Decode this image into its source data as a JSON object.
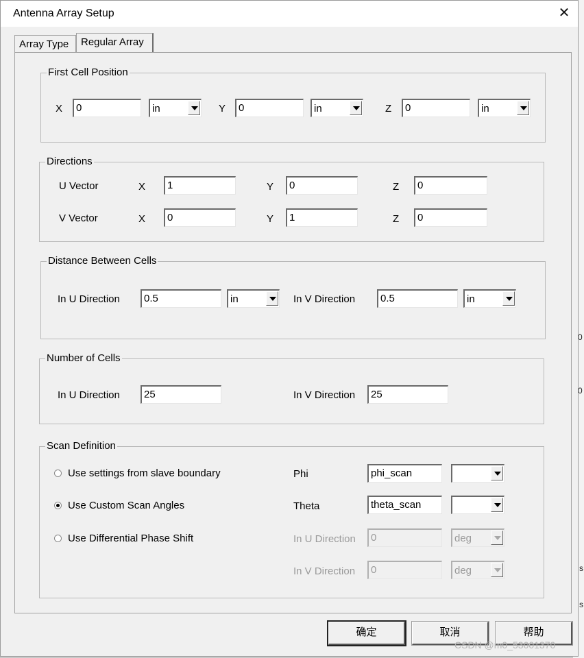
{
  "window": {
    "title": "Antenna Array Setup",
    "close_glyph": "✕"
  },
  "tabs": [
    {
      "label": "Array Type"
    },
    {
      "label": "Regular Array"
    }
  ],
  "first_cell": {
    "legend": "First Cell Position",
    "x_label": "X",
    "x_value": "0",
    "x_unit": "in",
    "y_label": "Y",
    "y_value": "0",
    "y_unit": "in",
    "z_label": "Z",
    "z_value": "0",
    "z_unit": "in"
  },
  "directions": {
    "legend": "Directions",
    "u_label": "U Vector",
    "v_label": "V Vector",
    "x_label": "X",
    "y_label": "Y",
    "z_label": "Z",
    "u": {
      "x": "1",
      "y": "0",
      "z": "0"
    },
    "v": {
      "x": "0",
      "y": "1",
      "z": "0"
    }
  },
  "distance": {
    "legend": "Distance Between Cells",
    "u_label": "In U Direction",
    "u_value": "0.5",
    "u_unit": "in",
    "v_label": "In V Direction",
    "v_value": "0.5",
    "v_unit": "in"
  },
  "number": {
    "legend": "Number of Cells",
    "u_label": "In U Direction",
    "u_value": "25",
    "v_label": "In V Direction",
    "v_value": "25"
  },
  "scan": {
    "legend": "Scan Definition",
    "options": [
      {
        "label": "Use settings from slave boundary",
        "checked": false
      },
      {
        "label": "Use Custom Scan Angles",
        "checked": true
      },
      {
        "label": "Use Differential Phase Shift",
        "checked": false
      }
    ],
    "phi_label": "Phi",
    "phi_value": "phi_scan",
    "phi_unit": "",
    "theta_label": "Theta",
    "theta_value": "theta_scan",
    "theta_unit": "",
    "u_label": "In U Direction",
    "u_value": "0",
    "u_unit": "deg",
    "v_label": "In V Direction",
    "v_value": "0",
    "v_unit": "deg"
  },
  "buttons": {
    "ok": "确定",
    "cancel": "取消",
    "help": "帮助"
  },
  "watermark": "CSDN @m0_53001370",
  "background_fragments": {
    "a": "0",
    "b": "0",
    "c": "s",
    "d": "s"
  }
}
